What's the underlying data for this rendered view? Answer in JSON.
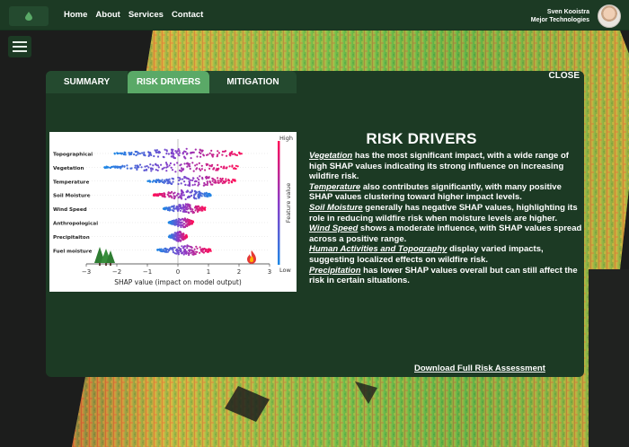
{
  "navbar": {
    "logo_icon": "leaf-drop-icon",
    "links": [
      "Home",
      "About",
      "Services",
      "Contact"
    ],
    "user_name": "Sven Kooistra",
    "user_company": "Mejor Technologies"
  },
  "panel": {
    "tabs": [
      "SUMMARY",
      "RISK DRIVERS",
      "MITIGATION"
    ],
    "active_tab": "RISK DRIVERS",
    "close_label": "CLOSE",
    "title": "RISK DRIVERS",
    "paragraphs": [
      {
        "term": "Vegetation",
        "text": " has the most significant impact, with a wide range of high SHAP values indicating its strong influence on increasing wildfire risk."
      },
      {
        "term": "Temperature",
        "text": " also contributes significantly, with many positive SHAP values clustering toward higher impact levels."
      },
      {
        "term": "Soil Moisture",
        "text": " generally has negative SHAP values, highlighting its role in reducing wildfire risk when moisture levels are higher."
      },
      {
        "term": "Wind Speed",
        "text": " shows a moderate influence, with SHAP values spread across a positive range."
      },
      {
        "term": "Human Activities and Topography",
        "text": " display varied impacts, suggesting localized effects on wildfire risk."
      },
      {
        "term": "Precipitation",
        "text": " has lower SHAP values overall but can still affect the risk in certain situations."
      }
    ],
    "download_label": "Download Full Risk Assessment"
  },
  "chart_data": {
    "type": "scatter",
    "features": [
      "Topographical",
      "Vegetation",
      "Temperature",
      "Soil Moisture",
      "Wind Speed",
      "Anthropological",
      "Precipitaiton",
      "Fuel moisture"
    ],
    "shap_ranges": [
      [
        -2.1,
        2.2
      ],
      [
        -2.4,
        2.0
      ],
      [
        -1.0,
        1.9
      ],
      [
        -0.8,
        1.1
      ],
      [
        -0.5,
        0.9
      ],
      [
        -0.3,
        0.5
      ],
      [
        -0.3,
        0.3
      ],
      [
        -0.7,
        1.1
      ]
    ],
    "xlabel": "SHAP value (impact on model output)",
    "xlim": [
      -3,
      3
    ],
    "xticks": [
      "−3",
      "−2",
      "−1",
      "0",
      "1",
      "2",
      "3"
    ],
    "colorbar_label": "Feature value",
    "colorbar_high": "High",
    "colorbar_low": "Low",
    "low_color": "#1e88e5",
    "high_color": "#ff0d57",
    "corner_icons": [
      "tree-icon",
      "fire-icon"
    ]
  }
}
